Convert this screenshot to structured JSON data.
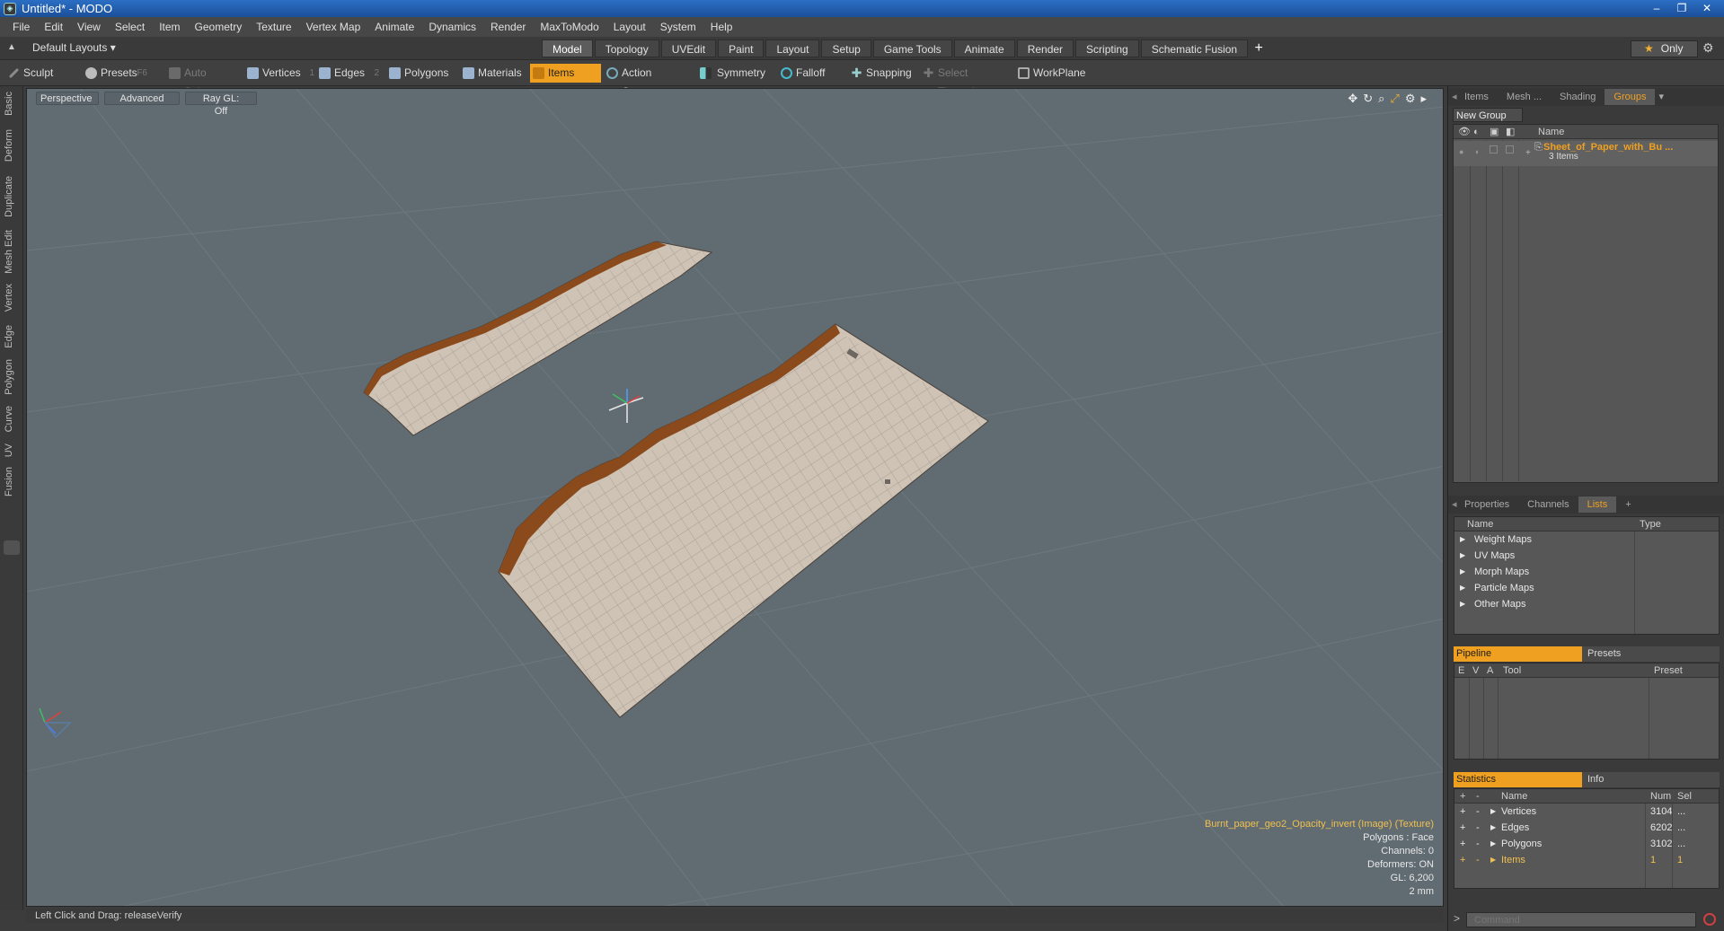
{
  "window": {
    "title": "Untitled* - MODO",
    "app_icon": "modo-logo-icon",
    "controls": [
      "minimize-icon",
      "restore-icon",
      "close-icon"
    ]
  },
  "menu": [
    "File",
    "Edit",
    "View",
    "Select",
    "Item",
    "Geometry",
    "Texture",
    "Vertex Map",
    "Animate",
    "Dynamics",
    "Render",
    "MaxToModo",
    "Layout",
    "System",
    "Help"
  ],
  "layout": {
    "dropdown": "Default Layouts ▾",
    "tabs": [
      "Model",
      "Topology",
      "UVEdit",
      "Paint",
      "Layout",
      "Setup",
      "Game Tools",
      "Animate",
      "Render",
      "Scripting",
      "Schematic Fusion"
    ],
    "active_tab": "Model",
    "add_tab": "+",
    "only_label": "Only"
  },
  "toolbar": {
    "sculpt": "Sculpt",
    "presets": "Presets",
    "presets_key": "F6",
    "auto_select": "Auto Select",
    "vertices": "Vertices",
    "vertices_key": "1",
    "edges": "Edges",
    "edges_key": "2",
    "polygons": "Polygons",
    "materials": "Materials",
    "items": "Items",
    "action_center": "Action Center",
    "symmetry": "Symmetry",
    "falloff": "Falloff",
    "snapping": "Snapping",
    "select_through": "Select Through",
    "workplane": "WorkPlane"
  },
  "left_tabs": [
    "Basic",
    "Deform",
    "Duplicate",
    "Mesh Edit",
    "Vertex",
    "Edge",
    "Polygon",
    "Curve",
    "UV",
    "Fusion"
  ],
  "viewport": {
    "view": "Perspective",
    "shading": "Advanced",
    "raygl": "Ray GL: Off",
    "info": {
      "texture": "Burnt_paper_geo2_Opacity_invert (Image) (Texture)",
      "polygons": "Polygons : Face",
      "channels": "Channels: 0",
      "deformers": "Deformers: ON",
      "gl": "GL: 6,200",
      "scale": "2 mm"
    },
    "colors": {
      "background": "#606b72",
      "paper": "#cfc3b5",
      "burn": "#8a4a1c",
      "accent": "#f0a020"
    }
  },
  "status_line": "Left Click and Drag:   releaseVerify",
  "groups_panel": {
    "tabs": [
      "Items",
      "Mesh ...",
      "Shading",
      "Groups"
    ],
    "active_tab": "Groups",
    "new_group": "New Group",
    "name_header": "Name",
    "group_name": "Sheet_of_Paper_with_Bu ...",
    "group_count": "3 Items"
  },
  "lists_panel": {
    "tabs": [
      "Properties",
      "Channels",
      "Lists"
    ],
    "active_tab": "Lists",
    "add": "+",
    "headers": {
      "name": "Name",
      "type": "Type"
    },
    "items": [
      "Weight Maps",
      "UV Maps",
      "Morph Maps",
      "Particle Maps",
      "Other Maps"
    ]
  },
  "pipeline_panel": {
    "tab_on": "Pipeline",
    "tab_off": "Presets",
    "headers": {
      "e": "E",
      "v": "V",
      "a": "A",
      "tool": "Tool",
      "preset": "Preset"
    }
  },
  "stats_panel": {
    "tab_on": "Statistics",
    "tab_off": "Info",
    "headers": {
      "plus": "+",
      "minus": "-",
      "name": "Name",
      "num": "Num",
      "sel": "Sel"
    },
    "rows": [
      {
        "name": "Vertices",
        "num": "3104",
        "sel": "..."
      },
      {
        "name": "Edges",
        "num": "6202",
        "sel": "..."
      },
      {
        "name": "Polygons",
        "num": "3102",
        "sel": "..."
      },
      {
        "name": "Items",
        "num": "1",
        "sel": "1"
      }
    ]
  },
  "command": {
    "prompt": ">",
    "placeholder": "Command"
  }
}
